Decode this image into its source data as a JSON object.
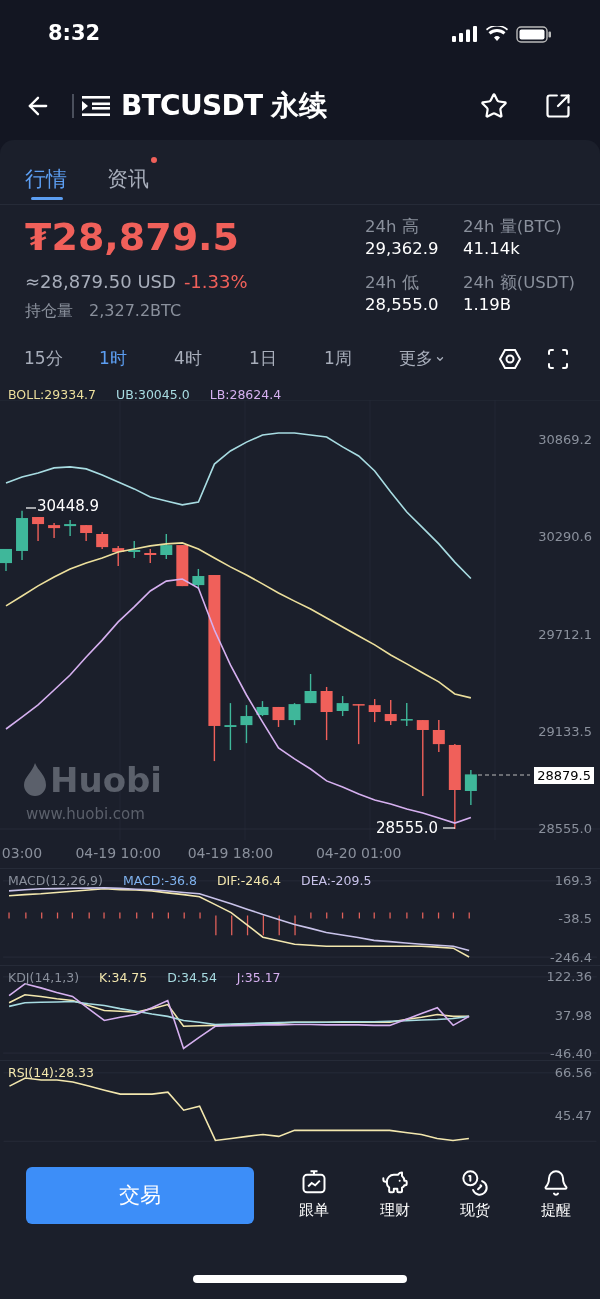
{
  "status_bar": {
    "time": "8:32"
  },
  "header": {
    "title": "BTCUSDT 永续"
  },
  "tabs": [
    {
      "label": "行情",
      "selected": true,
      "badge": false
    },
    {
      "label": "资讯",
      "selected": false,
      "badge": true
    }
  ],
  "ticker": {
    "price": "₮28,879.5",
    "usd": "≈28,879.50 USD",
    "change": "-1.33%",
    "open_interest_label": "持仓量",
    "open_interest": "2,327.2BTC",
    "stats": [
      {
        "label": "24h 高",
        "value": "29,362.9"
      },
      {
        "label": "24h 量(BTC)",
        "value": "41.14k"
      },
      {
        "label": "24h 低",
        "value": "28,555.0"
      },
      {
        "label": "24h 额(USDT)",
        "value": "1.19B"
      }
    ]
  },
  "intervals": [
    {
      "label": "15分",
      "selected": false,
      "kind": "option"
    },
    {
      "label": "1时",
      "selected": true,
      "kind": "option"
    },
    {
      "label": "4时",
      "selected": false,
      "kind": "option"
    },
    {
      "label": "1日",
      "selected": false,
      "kind": "option"
    },
    {
      "label": "1周",
      "selected": false,
      "kind": "option"
    },
    {
      "label": "更多",
      "selected": false,
      "kind": "dropdown"
    }
  ],
  "chart": {
    "legend": [
      {
        "text": "BOLL:29334.7",
        "color": "#ecdf9c"
      },
      {
        "text": "UB:30045.0",
        "color": "#a8dce2"
      },
      {
        "text": "LB:28624.4",
        "color": "#d6b0f0"
      }
    ],
    "chart_data": {
      "type": "candlestick",
      "categories": [
        null,
        "03:00",
        null,
        null,
        null,
        null,
        null,
        "04-19 10:00",
        null,
        null,
        null,
        null,
        null,
        null,
        "04-19 18:00",
        null,
        null,
        null,
        null,
        null,
        null,
        null,
        "04-20 01:00",
        null,
        null,
        null,
        null,
        null,
        null,
        null
      ],
      "ylim": [
        28555.0,
        31107
      ],
      "yticks": [
        {
          "value": 28555.0,
          "label": "28555.0"
        },
        {
          "value": 29133.5,
          "label": "29133.5"
        },
        {
          "value": 29712.1,
          "label": "29712.1"
        },
        {
          "value": 30290.6,
          "label": "30290.6"
        },
        {
          "value": 30869.2,
          "label": "30869.2"
        }
      ],
      "ohlc": [
        [
          30137,
          30221,
          30090,
          30221
        ],
        [
          30209,
          30449,
          30155,
          30405
        ],
        [
          30411,
          30411,
          30268,
          30369
        ],
        [
          30363,
          30375,
          30286,
          30345
        ],
        [
          30357,
          30393,
          30298,
          30369
        ],
        [
          30363,
          30363,
          30268,
          30316
        ],
        [
          30310,
          30322,
          30221,
          30232
        ],
        [
          30226,
          30238,
          30119,
          30203
        ],
        [
          30203,
          30268,
          30167,
          30215
        ],
        [
          30197,
          30221,
          30137,
          30185
        ],
        [
          30185,
          30310,
          30161,
          30244
        ],
        [
          30244,
          30244,
          30000,
          30000
        ],
        [
          30006,
          30102,
          29983,
          30060
        ],
        [
          30066,
          30066,
          28959,
          29168
        ],
        [
          29162,
          29304,
          29025,
          29173
        ],
        [
          29173,
          29292,
          29066,
          29227
        ],
        [
          29233,
          29316,
          29227,
          29281
        ],
        [
          29281,
          29281,
          29162,
          29203
        ],
        [
          29203,
          29304,
          29173,
          29298
        ],
        [
          29304,
          29477,
          29304,
          29376
        ],
        [
          29376,
          29400,
          29084,
          29251
        ],
        [
          29257,
          29346,
          29227,
          29304
        ],
        [
          29298,
          29298,
          29060,
          29292
        ],
        [
          29292,
          29328,
          29191,
          29251
        ],
        [
          29239,
          29322,
          29173,
          29197
        ],
        [
          29203,
          29304,
          29168,
          29209
        ],
        [
          29203,
          29203,
          28751,
          29144
        ],
        [
          29144,
          29203,
          29013,
          29060
        ],
        [
          29055,
          29060,
          28555,
          28787
        ],
        [
          28781,
          28906,
          28698,
          28880
        ]
      ],
      "series": [
        {
          "type": "line",
          "color": "#a8dce2",
          "values": [
            30613,
            30649,
            30673,
            30703,
            30709,
            30697,
            30661,
            30619,
            30578,
            30530,
            30506,
            30483,
            30500,
            30726,
            30804,
            30857,
            30899,
            30911,
            30911,
            30899,
            30887,
            30828,
            30774,
            30685,
            30560,
            30441,
            30346,
            30251,
            30143,
            30045
          ]
        },
        {
          "type": "line",
          "color": "#ecdf9c",
          "values": [
            29882,
            29941,
            30001,
            30054,
            30102,
            30138,
            30167,
            30203,
            30221,
            30239,
            30251,
            30257,
            30221,
            30167,
            30114,
            30066,
            30013,
            29959,
            29911,
            29864,
            29810,
            29757,
            29703,
            29650,
            29590,
            29537,
            29483,
            29430,
            29358,
            29335
          ]
        },
        {
          "type": "line",
          "color": "#d6b0f0",
          "values": [
            29150,
            29221,
            29293,
            29382,
            29471,
            29578,
            29679,
            29787,
            29876,
            29971,
            30030,
            30042,
            29989,
            29739,
            29531,
            29352,
            29192,
            29037,
            28972,
            28912,
            28841,
            28805,
            28763,
            28728,
            28704,
            28674,
            28650,
            28621,
            28590,
            28624
          ]
        }
      ]
    },
    "last_price": "28879.5",
    "high_marker": "30448.9",
    "low_marker": "28555.0",
    "watermark": {
      "brand": "Huobi",
      "url": "www.huobi.com"
    }
  },
  "indicators": [
    {
      "kind": "macd",
      "legend": [
        {
          "text": "MACD(12,26,9)",
          "color": "#8a909c"
        },
        {
          "text": "MACD:-36.8",
          "color": "#7fb2ee"
        },
        {
          "text": "DIF:-246.4",
          "color": "#f3e7ae"
        },
        {
          "text": "DEA:-209.5",
          "color": "#c9c3ea"
        }
      ],
      "chart_data": {
        "type": "line",
        "categories": [
          null,
          null,
          null,
          null,
          null,
          null,
          null,
          null,
          null,
          null,
          null,
          null,
          null,
          null,
          null,
          null,
          null,
          null,
          null,
          null,
          null,
          null,
          null,
          null,
          null,
          null,
          null,
          null,
          null,
          null
        ],
        "ylim": [
          -246.4,
          169.3
        ],
        "yticks": [
          {
            "value": -246.4,
            "label": "-246.4"
          },
          {
            "value": -38.5,
            "label": "-38.5"
          },
          {
            "value": 169.3,
            "label": "169.3"
          }
        ],
        "series": [
          {
            "color": "#f3e7ae",
            "values": [
              88,
              94,
              99,
              106,
              113,
              119,
              126,
              122,
              119,
              115,
              104,
              94,
              83,
              40,
              -4,
              -71,
              -138,
              -157,
              -176,
              -182,
              -187,
              -187,
              -187,
              -187,
              -187,
              -187,
              -187,
              -192,
              -198,
              -246
            ]
          },
          {
            "color": "#c9c3ea",
            "values": [
              115,
              121,
              126,
              127,
              129,
              130,
              132,
              128,
              124,
              121,
              114,
              106,
              99,
              72,
              45,
              15,
              -14,
              -41,
              -68,
              -90,
              -112,
              -126,
              -140,
              -155,
              -162,
              -169,
              -176,
              -182,
              -187,
              -210
            ]
          }
        ]
      }
    },
    {
      "kind": "kdj",
      "legend": [
        {
          "text": "KDJ(14,1,3)",
          "color": "#8a909c"
        },
        {
          "text": "K:34.75",
          "color": "#f3e7ae"
        },
        {
          "text": "D:34.54",
          "color": "#a8dce2"
        },
        {
          "text": "J:35.17",
          "color": "#d6b0f0"
        }
      ],
      "chart_data": {
        "type": "line",
        "categories": [
          null,
          null,
          null,
          null,
          null,
          null,
          null,
          null,
          null,
          null,
          null,
          null,
          null,
          null,
          null,
          null,
          null,
          null,
          null,
          null,
          null,
          null,
          null,
          null,
          null,
          null,
          null,
          null,
          null,
          null
        ],
        "ylim": [
          -46.4,
          122.36
        ],
        "yticks": [
          {
            "value": -46.4,
            "label": "-46.40"
          },
          {
            "value": 37.98,
            "label": "37.98"
          },
          {
            "value": 122.36,
            "label": "122.36"
          }
        ],
        "series": [
          {
            "color": "#f3e7ae",
            "values": [
              65,
              83,
              79,
              74,
              70,
              59,
              48,
              46,
              44,
              52,
              61,
              13,
              14,
              15,
              16,
              18,
              19,
              20,
              22,
              22,
              22,
              22,
              22,
              22,
              22,
              28,
              33,
              39,
              35,
              35
            ]
          },
          {
            "color": "#a8dce2",
            "values": [
              57,
              65,
              66,
              67,
              68,
              63,
              59,
              52,
              46,
              40,
              35,
              26,
              22,
              17,
              18,
              19,
              20,
              21,
              22,
              22,
              22,
              23,
              23,
              23,
              24,
              25,
              27,
              28,
              30,
              35
            ]
          },
          {
            "color": "#d6b0f0",
            "values": [
              81,
              107,
              98,
              88,
              79,
              52,
              26,
              33,
              39,
              54,
              70,
              -36,
              -11,
              13,
              14,
              15,
              16,
              16,
              17,
              17,
              16,
              16,
              16,
              15,
              15,
              28,
              41,
              54,
              15,
              35
            ]
          }
        ]
      }
    },
    {
      "kind": "rsi",
      "legend": [
        {
          "text": "RSI(14):28.33",
          "color": "#f3e7ae"
        }
      ],
      "chart_data": {
        "type": "line",
        "categories": [
          null,
          null,
          null,
          null,
          null,
          null,
          null,
          null,
          null,
          null,
          null,
          null,
          null,
          null,
          null,
          null,
          null,
          null,
          null,
          null,
          null,
          null,
          null,
          null,
          null,
          null,
          null,
          null,
          null,
          null
        ],
        "ylim": [
          32.6,
          66.56
        ],
        "yticks": [
          {
            "value": 45.47,
            "label": "45.47"
          },
          {
            "value": 66.56,
            "label": "66.56"
          }
        ],
        "series": [
          {
            "color": "#f3e7ae",
            "values": [
              60,
              64,
              63,
              63,
              62,
              60,
              58,
              56,
              56,
              56,
              57,
              48,
              50,
              33,
              34,
              35,
              36,
              35,
              38,
              38,
              38,
              38,
              38,
              38,
              38,
              37,
              36,
              34,
              33,
              34
            ]
          }
        ]
      }
    }
  ],
  "bottom_bar": {
    "trade_button": "交易",
    "items": [
      {
        "label": "跟单"
      },
      {
        "label": "理财"
      },
      {
        "label": "现货"
      },
      {
        "label": "提醒"
      }
    ]
  }
}
